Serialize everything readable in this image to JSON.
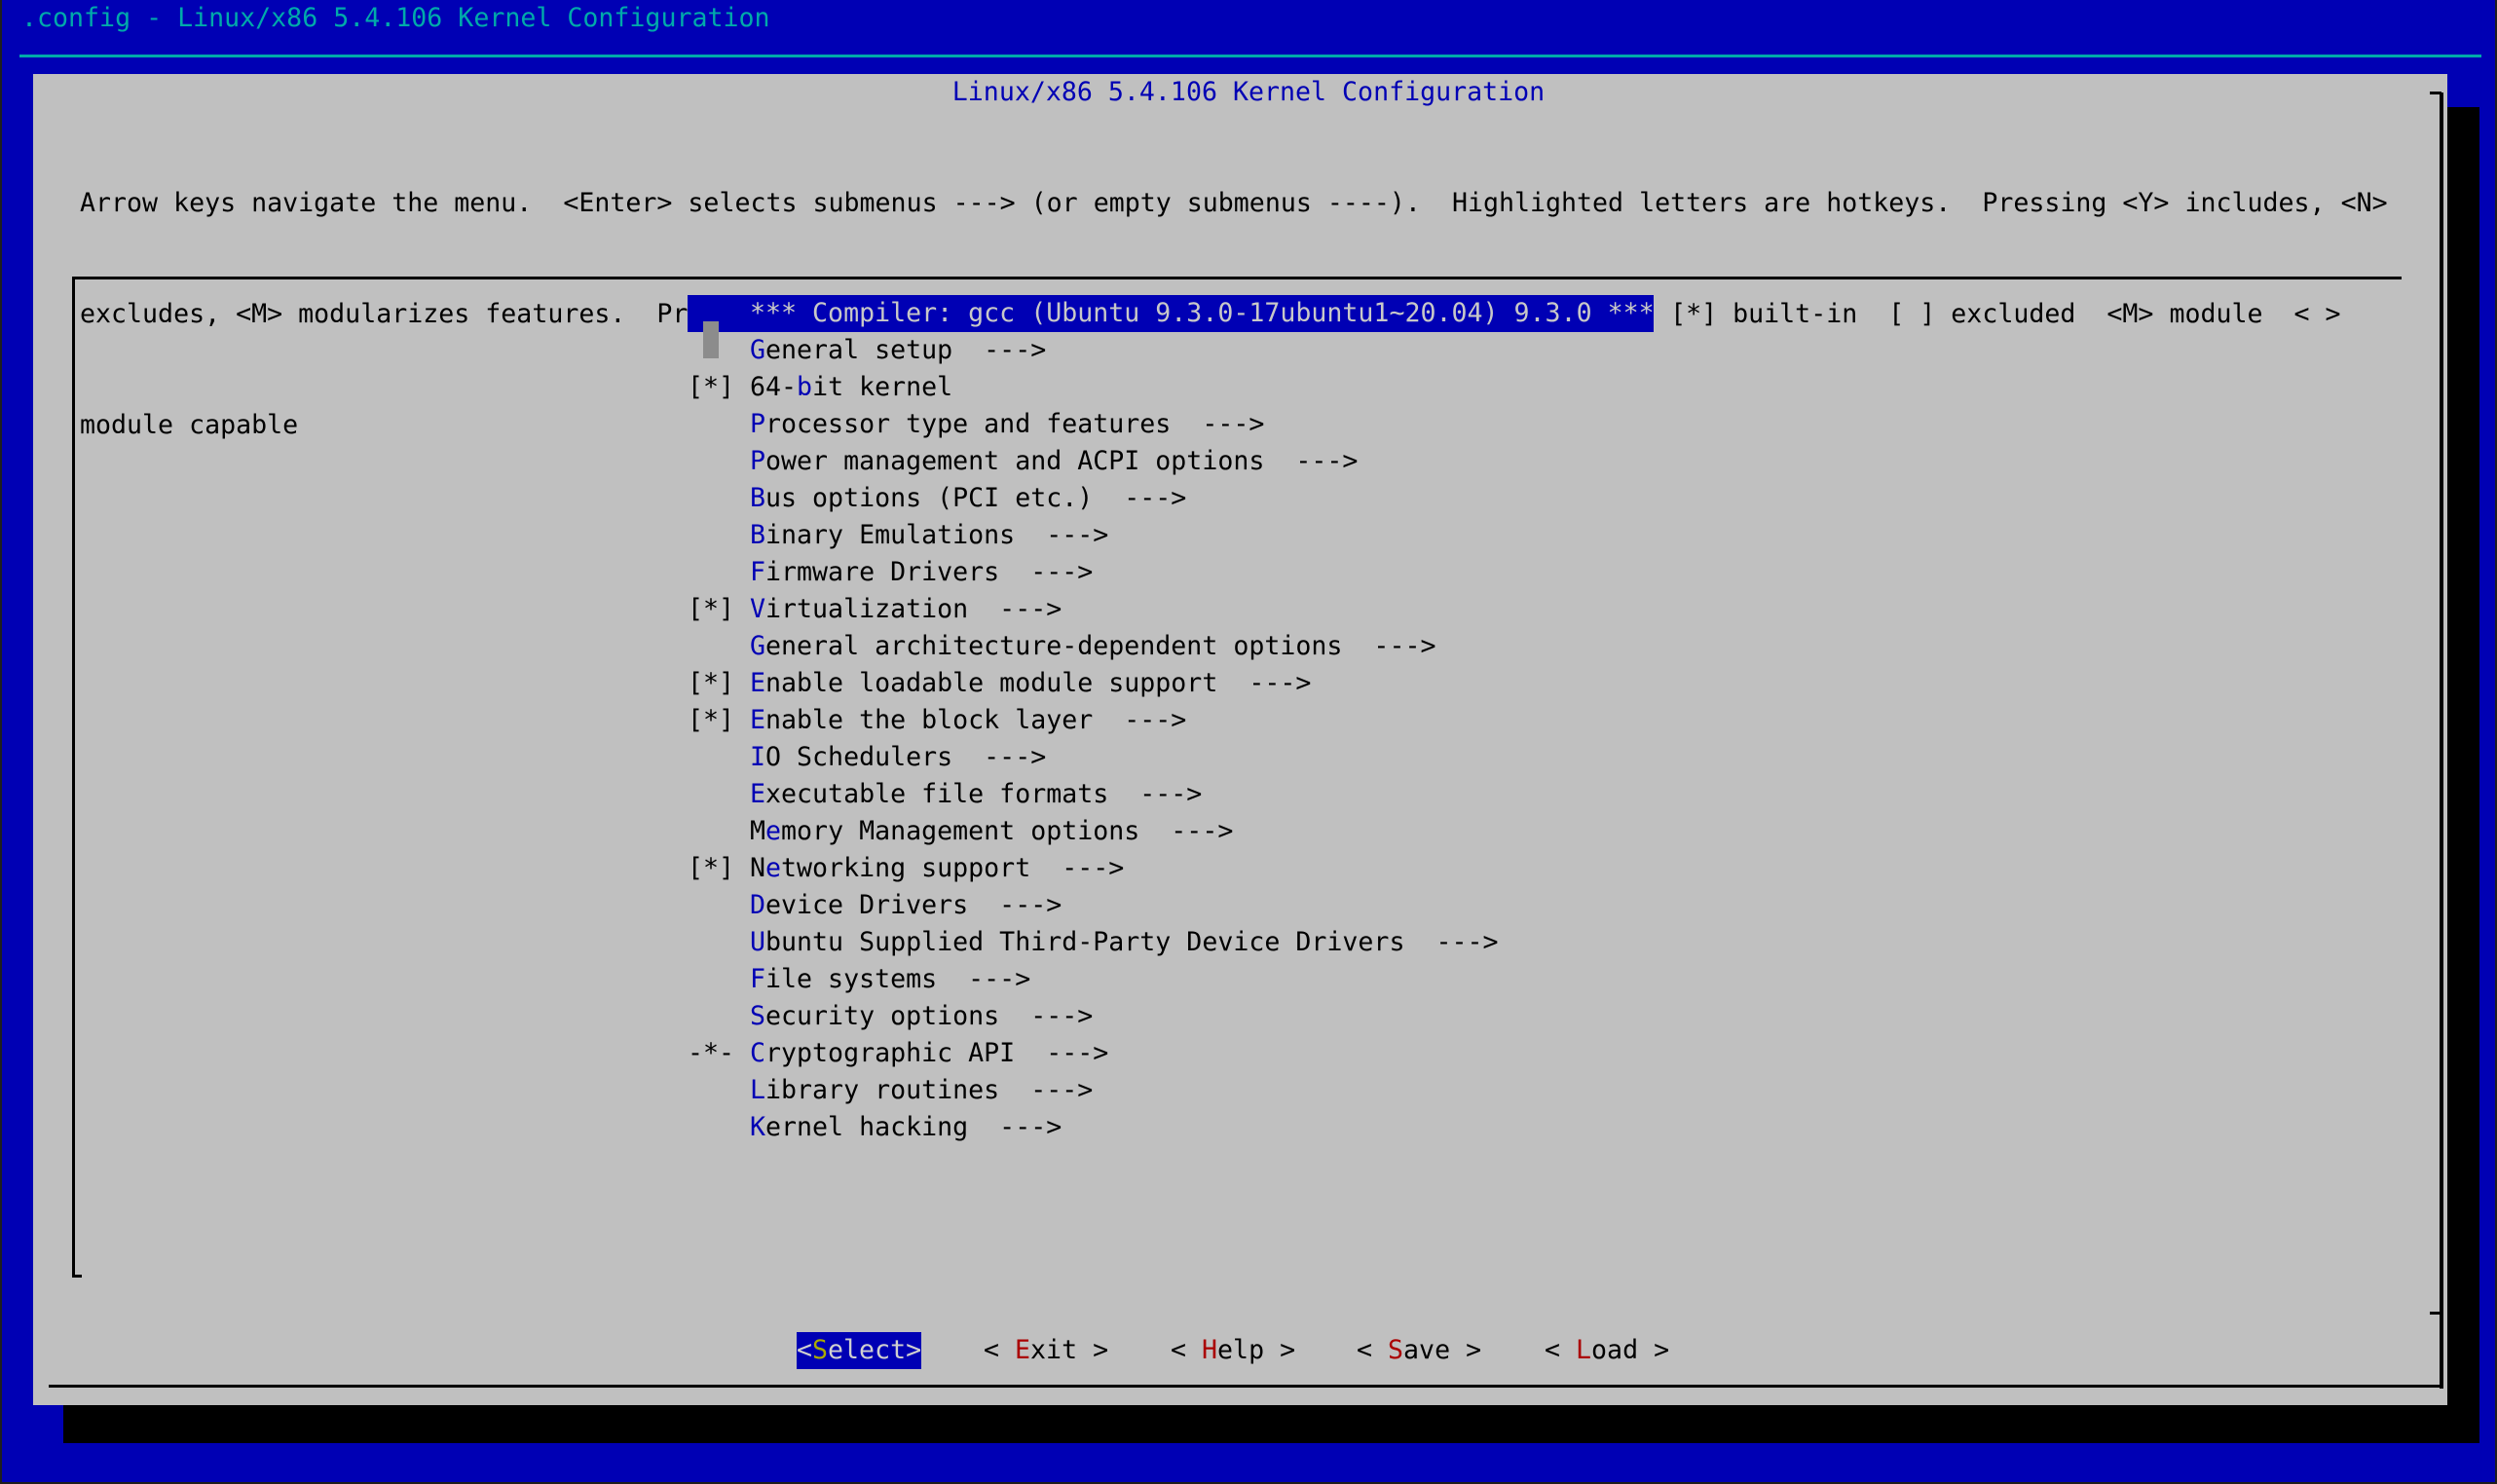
{
  "window": {
    "title": ".config - Linux/x86 5.4.106 Kernel Configuration"
  },
  "dialog": {
    "title": "Linux/x86 5.4.106 Kernel Configuration",
    "help_lines": [
      "Arrow keys navigate the menu.  <Enter> selects submenus ---> (or empty submenus ----).  Highlighted letters are hotkeys.  Pressing <Y> includes, <N>",
      "excludes, <M> modularizes features.  Press <Esc><Esc> to exit, <?> for Help, </> for Search.  Legend: [*] built-in  [ ] excluded  <M> module  < >",
      "module capable"
    ]
  },
  "menu": {
    "items": [
      {
        "prefix": "",
        "label": "*** Compiler: gcc (Ubuntu 9.3.0-17ubuntu1~20.04) 9.3.0 ***",
        "hotkey": -1,
        "selected": true
      },
      {
        "prefix": "",
        "label": "General setup  --->",
        "hotkey": 0
      },
      {
        "prefix": "[*]",
        "label": "64-bit kernel",
        "hotkey": 3
      },
      {
        "prefix": "",
        "label": "Processor type and features  --->",
        "hotkey": 0
      },
      {
        "prefix": "",
        "label": "Power management and ACPI options  --->",
        "hotkey": 0
      },
      {
        "prefix": "",
        "label": "Bus options (PCI etc.)  --->",
        "hotkey": 0
      },
      {
        "prefix": "",
        "label": "Binary Emulations  --->",
        "hotkey": 0
      },
      {
        "prefix": "",
        "label": "Firmware Drivers  --->",
        "hotkey": 0
      },
      {
        "prefix": "[*]",
        "label": "Virtualization  --->",
        "hotkey": 0
      },
      {
        "prefix": "",
        "label": "General architecture-dependent options  --->",
        "hotkey": 0
      },
      {
        "prefix": "[*]",
        "label": "Enable loadable module support  --->",
        "hotkey": 0
      },
      {
        "prefix": "[*]",
        "label": "Enable the block layer  --->",
        "hotkey": 0
      },
      {
        "prefix": "",
        "label": "IO Schedulers  --->",
        "hotkey": 0
      },
      {
        "prefix": "",
        "label": "Executable file formats  --->",
        "hotkey": 0
      },
      {
        "prefix": "",
        "label": "Memory Management options  --->",
        "hotkey": 1
      },
      {
        "prefix": "[*]",
        "label": "Networking support  --->",
        "hotkey": 1
      },
      {
        "prefix": "",
        "label": "Device Drivers  --->",
        "hotkey": 0
      },
      {
        "prefix": "",
        "label": "Ubuntu Supplied Third-Party Device Drivers  --->",
        "hotkey": 0
      },
      {
        "prefix": "",
        "label": "File systems  --->",
        "hotkey": 0
      },
      {
        "prefix": "",
        "label": "Security options  --->",
        "hotkey": 0
      },
      {
        "prefix": "-*-",
        "label": "Cryptographic API  --->",
        "hotkey": 0
      },
      {
        "prefix": "",
        "label": "Library routines  --->",
        "hotkey": 0
      },
      {
        "prefix": "",
        "label": "Kernel hacking  --->",
        "hotkey": 0
      }
    ]
  },
  "buttons": [
    {
      "id": "select",
      "open": "<",
      "label": "Select",
      "close": ">",
      "active": true
    },
    {
      "id": "exit",
      "open": "< ",
      "label": "Exit",
      "close": " >",
      "active": false
    },
    {
      "id": "help",
      "open": "< ",
      "label": "Help",
      "close": " >",
      "active": false
    },
    {
      "id": "save",
      "open": "< ",
      "label": "Save",
      "close": " >",
      "active": false
    },
    {
      "id": "load",
      "open": "< ",
      "label": "Load",
      "close": " >",
      "active": false
    }
  ],
  "colors": {
    "background": "#0000b4",
    "dialog": "#c0c0c0",
    "backtitle": "#00aaaa",
    "hotkey": "#0000b4",
    "button_hotkey": "#aa0000",
    "active_button_hotkey": "#aaaa00"
  }
}
